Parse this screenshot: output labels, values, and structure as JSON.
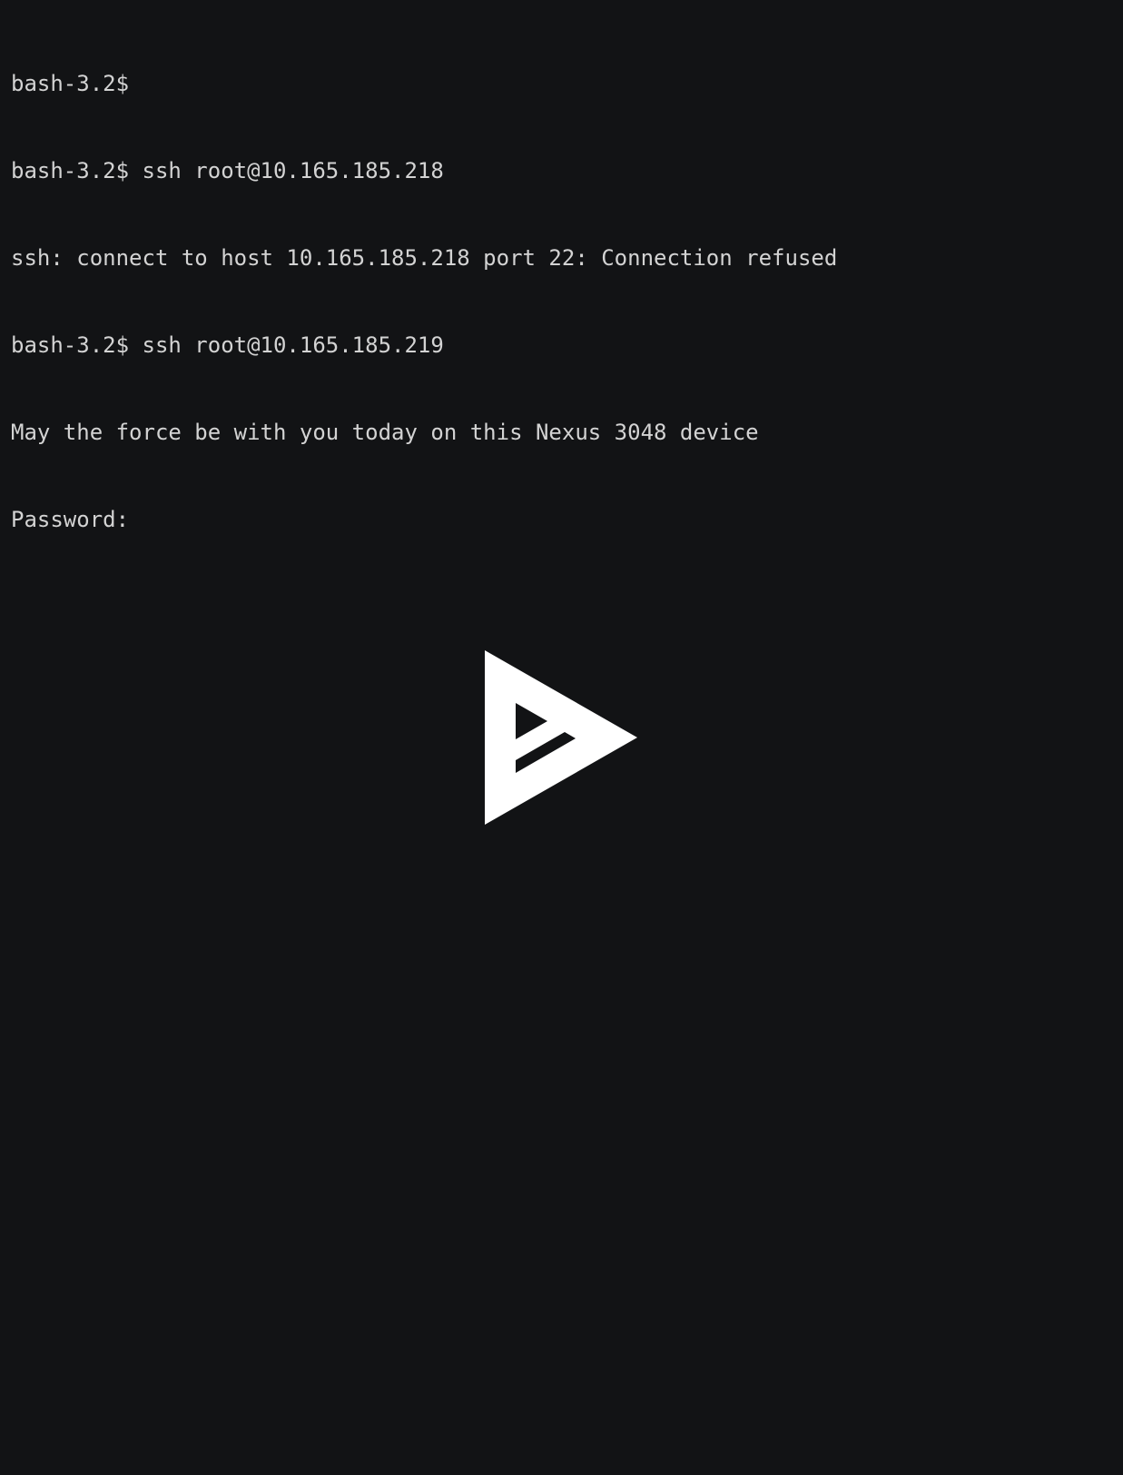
{
  "terminal": {
    "background": "#121315",
    "text_color": "#d3d3d3",
    "lines": [
      "bash-3.2$",
      "bash-3.2$ ssh root@10.165.185.218",
      "ssh: connect to host 10.165.185.218 port 22: Connection refused",
      "bash-3.2$ ssh root@10.165.185.219",
      "May the force be with you today on this Nexus 3048 device",
      "Password:"
    ]
  },
  "logo": {
    "icon": "asciinema-play-logo-icon",
    "color": "#ffffff"
  }
}
